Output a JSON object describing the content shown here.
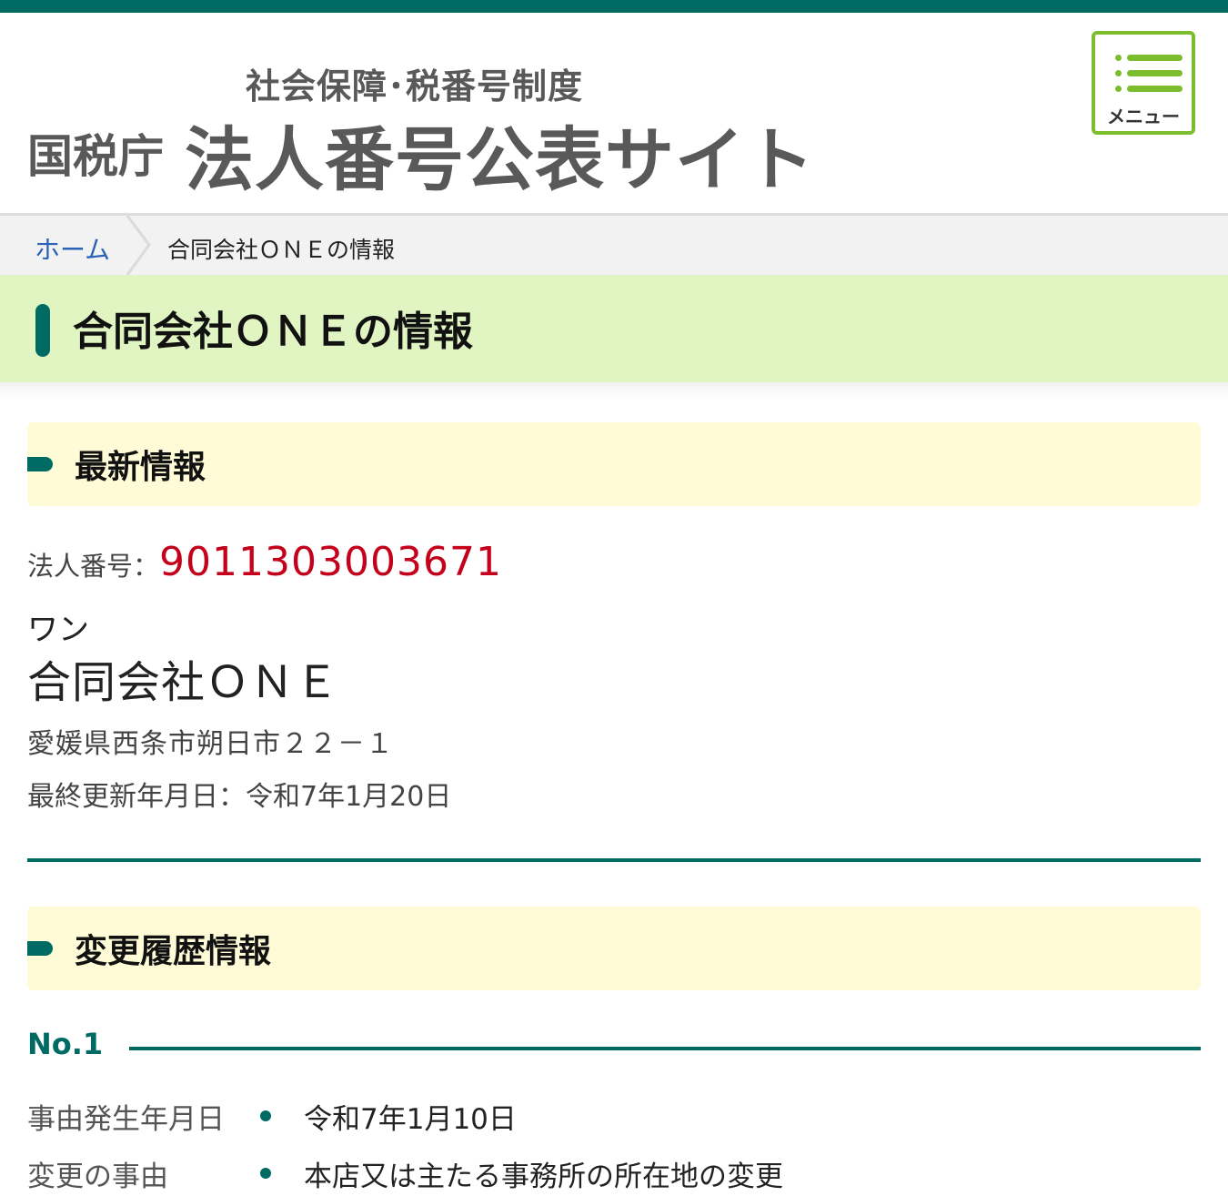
{
  "header": {
    "subtitle": "社会保障･税番号制度",
    "agency": "国税庁",
    "site_title": "法人番号公表サイト",
    "menu_label": "メニュー",
    "accent_color": "#006b63",
    "menu_color": "#7cbd2e"
  },
  "breadcrumb": {
    "home": "ホーム",
    "current": "合同会社ＯＮＥの情報"
  },
  "page": {
    "title": "合同会社ＯＮＥの情報"
  },
  "latest": {
    "heading": "最新情報",
    "number_label": "法人番号：",
    "number_value": "9011303003671",
    "furigana": "ワン",
    "name": "合同会社ＯＮＥ",
    "address": "愛媛県西条市朔日市２２－１",
    "updated": "最終更新年月日：令和7年1月20日"
  },
  "history": {
    "heading": "変更履歴情報",
    "entries": [
      {
        "no": "No.1",
        "rows": [
          {
            "key": "事由発生年月日",
            "value": "令和7年1月10日"
          },
          {
            "key": "変更の事由",
            "value": "本店又は主たる事務所の所在地の変更"
          }
        ]
      }
    ]
  }
}
